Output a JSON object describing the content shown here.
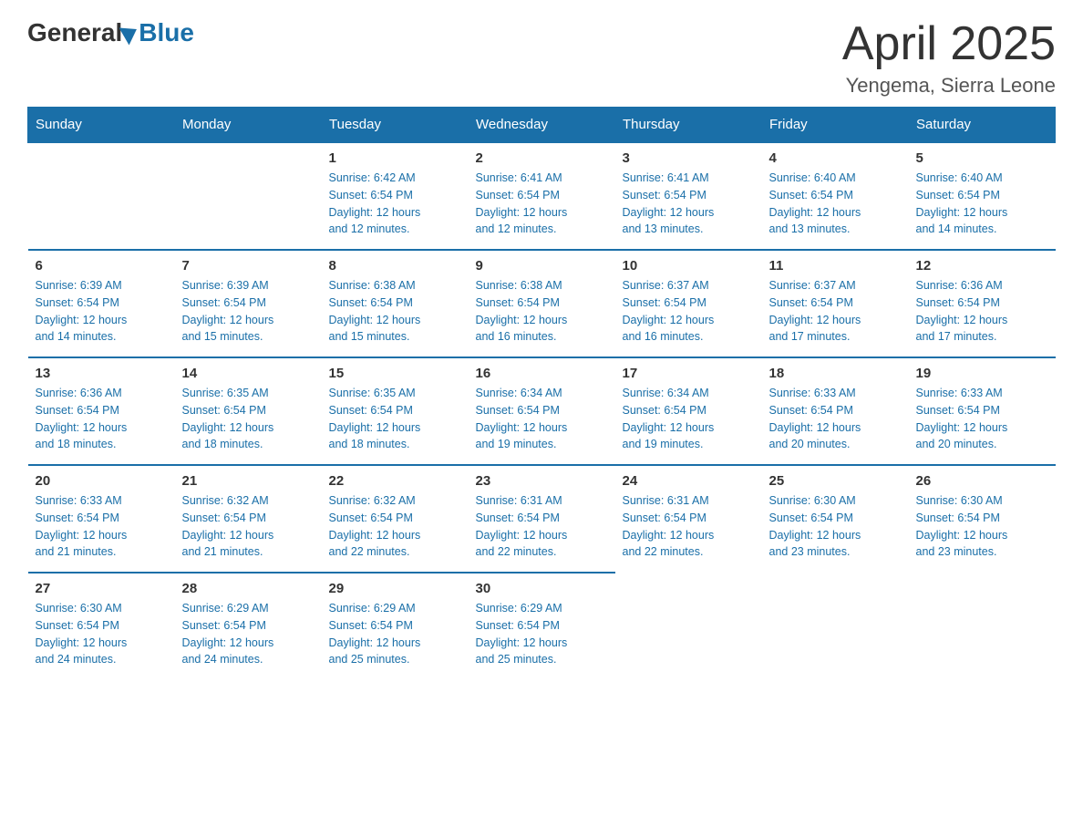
{
  "header": {
    "month_year": "April 2025",
    "location": "Yengema, Sierra Leone",
    "logo_general": "General",
    "logo_blue": "Blue"
  },
  "days_of_week": [
    "Sunday",
    "Monday",
    "Tuesday",
    "Wednesday",
    "Thursday",
    "Friday",
    "Saturday"
  ],
  "weeks": [
    [
      {
        "day": "",
        "info": ""
      },
      {
        "day": "",
        "info": ""
      },
      {
        "day": "1",
        "info": "Sunrise: 6:42 AM\nSunset: 6:54 PM\nDaylight: 12 hours\nand 12 minutes."
      },
      {
        "day": "2",
        "info": "Sunrise: 6:41 AM\nSunset: 6:54 PM\nDaylight: 12 hours\nand 12 minutes."
      },
      {
        "day": "3",
        "info": "Sunrise: 6:41 AM\nSunset: 6:54 PM\nDaylight: 12 hours\nand 13 minutes."
      },
      {
        "day": "4",
        "info": "Sunrise: 6:40 AM\nSunset: 6:54 PM\nDaylight: 12 hours\nand 13 minutes."
      },
      {
        "day": "5",
        "info": "Sunrise: 6:40 AM\nSunset: 6:54 PM\nDaylight: 12 hours\nand 14 minutes."
      }
    ],
    [
      {
        "day": "6",
        "info": "Sunrise: 6:39 AM\nSunset: 6:54 PM\nDaylight: 12 hours\nand 14 minutes."
      },
      {
        "day": "7",
        "info": "Sunrise: 6:39 AM\nSunset: 6:54 PM\nDaylight: 12 hours\nand 15 minutes."
      },
      {
        "day": "8",
        "info": "Sunrise: 6:38 AM\nSunset: 6:54 PM\nDaylight: 12 hours\nand 15 minutes."
      },
      {
        "day": "9",
        "info": "Sunrise: 6:38 AM\nSunset: 6:54 PM\nDaylight: 12 hours\nand 16 minutes."
      },
      {
        "day": "10",
        "info": "Sunrise: 6:37 AM\nSunset: 6:54 PM\nDaylight: 12 hours\nand 16 minutes."
      },
      {
        "day": "11",
        "info": "Sunrise: 6:37 AM\nSunset: 6:54 PM\nDaylight: 12 hours\nand 17 minutes."
      },
      {
        "day": "12",
        "info": "Sunrise: 6:36 AM\nSunset: 6:54 PM\nDaylight: 12 hours\nand 17 minutes."
      }
    ],
    [
      {
        "day": "13",
        "info": "Sunrise: 6:36 AM\nSunset: 6:54 PM\nDaylight: 12 hours\nand 18 minutes."
      },
      {
        "day": "14",
        "info": "Sunrise: 6:35 AM\nSunset: 6:54 PM\nDaylight: 12 hours\nand 18 minutes."
      },
      {
        "day": "15",
        "info": "Sunrise: 6:35 AM\nSunset: 6:54 PM\nDaylight: 12 hours\nand 18 minutes."
      },
      {
        "day": "16",
        "info": "Sunrise: 6:34 AM\nSunset: 6:54 PM\nDaylight: 12 hours\nand 19 minutes."
      },
      {
        "day": "17",
        "info": "Sunrise: 6:34 AM\nSunset: 6:54 PM\nDaylight: 12 hours\nand 19 minutes."
      },
      {
        "day": "18",
        "info": "Sunrise: 6:33 AM\nSunset: 6:54 PM\nDaylight: 12 hours\nand 20 minutes."
      },
      {
        "day": "19",
        "info": "Sunrise: 6:33 AM\nSunset: 6:54 PM\nDaylight: 12 hours\nand 20 minutes."
      }
    ],
    [
      {
        "day": "20",
        "info": "Sunrise: 6:33 AM\nSunset: 6:54 PM\nDaylight: 12 hours\nand 21 minutes."
      },
      {
        "day": "21",
        "info": "Sunrise: 6:32 AM\nSunset: 6:54 PM\nDaylight: 12 hours\nand 21 minutes."
      },
      {
        "day": "22",
        "info": "Sunrise: 6:32 AM\nSunset: 6:54 PM\nDaylight: 12 hours\nand 22 minutes."
      },
      {
        "day": "23",
        "info": "Sunrise: 6:31 AM\nSunset: 6:54 PM\nDaylight: 12 hours\nand 22 minutes."
      },
      {
        "day": "24",
        "info": "Sunrise: 6:31 AM\nSunset: 6:54 PM\nDaylight: 12 hours\nand 22 minutes."
      },
      {
        "day": "25",
        "info": "Sunrise: 6:30 AM\nSunset: 6:54 PM\nDaylight: 12 hours\nand 23 minutes."
      },
      {
        "day": "26",
        "info": "Sunrise: 6:30 AM\nSunset: 6:54 PM\nDaylight: 12 hours\nand 23 minutes."
      }
    ],
    [
      {
        "day": "27",
        "info": "Sunrise: 6:30 AM\nSunset: 6:54 PM\nDaylight: 12 hours\nand 24 minutes."
      },
      {
        "day": "28",
        "info": "Sunrise: 6:29 AM\nSunset: 6:54 PM\nDaylight: 12 hours\nand 24 minutes."
      },
      {
        "day": "29",
        "info": "Sunrise: 6:29 AM\nSunset: 6:54 PM\nDaylight: 12 hours\nand 25 minutes."
      },
      {
        "day": "30",
        "info": "Sunrise: 6:29 AM\nSunset: 6:54 PM\nDaylight: 12 hours\nand 25 minutes."
      },
      {
        "day": "",
        "info": ""
      },
      {
        "day": "",
        "info": ""
      },
      {
        "day": "",
        "info": ""
      }
    ]
  ]
}
